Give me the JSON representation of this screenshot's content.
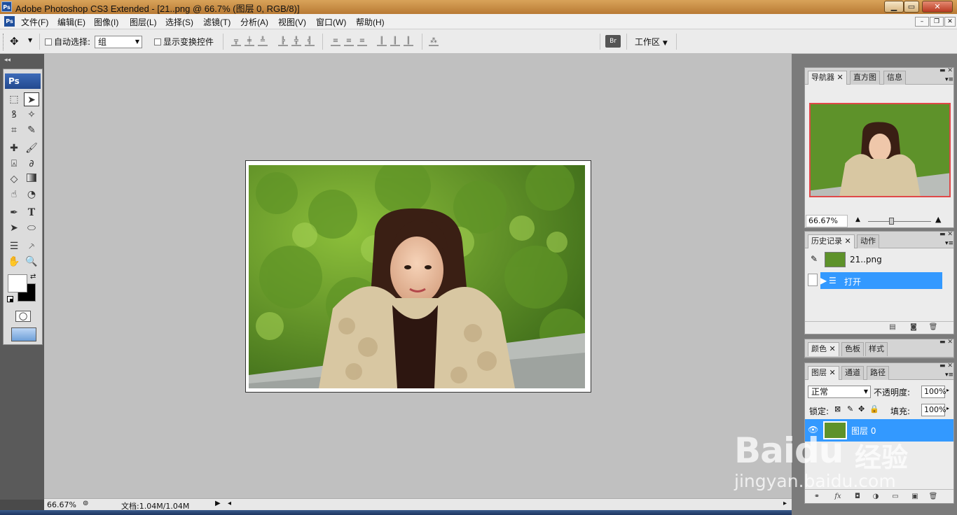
{
  "window": {
    "title": "Adobe Photoshop CS3 Extended - [21..png @ 66.7% (图层 0, RGB/8)]",
    "app_icon": "Ps",
    "controls": [
      "minimize",
      "maximize",
      "close"
    ]
  },
  "menu": [
    "文件(F)",
    "编辑(E)",
    "图像(I)",
    "图层(L)",
    "选择(S)",
    "滤镜(T)",
    "分析(A)",
    "视图(V)",
    "窗口(W)",
    "帮助(H)"
  ],
  "options": {
    "auto_select_label": "自动选择:",
    "auto_select_value": "组",
    "show_transform_label": "显示变换控件",
    "workspace_label": "工作区"
  },
  "toolbox": {
    "logo": "Ps",
    "text_tool": "T"
  },
  "status": {
    "zoom": "66.67%",
    "doc_info": "文档:1.04M/1.04M"
  },
  "navigator": {
    "tabs": [
      "导航器",
      "直方图",
      "信息"
    ],
    "zoom": "66.67%"
  },
  "history": {
    "tabs": [
      "历史记录",
      "动作"
    ],
    "snapshot": "21..png",
    "step": "打开"
  },
  "color_panel": {
    "tabs": [
      "颜色",
      "色板",
      "样式"
    ]
  },
  "layers_panel": {
    "tabs": [
      "图层",
      "通道",
      "路径"
    ],
    "blend_mode": "正常",
    "opacity_label": "不透明度:",
    "opacity": "100%",
    "lock_label": "锁定:",
    "fill_label": "填充:",
    "fill": "100%",
    "layer_name": "图层 0"
  },
  "watermark": {
    "brand": "Baidu",
    "cn": "经验",
    "url": "jingyan.baidu.com"
  },
  "colors": {
    "accent": "#3399ff",
    "canvas": "#c0c0c0",
    "titlebar": "#c98d45"
  }
}
